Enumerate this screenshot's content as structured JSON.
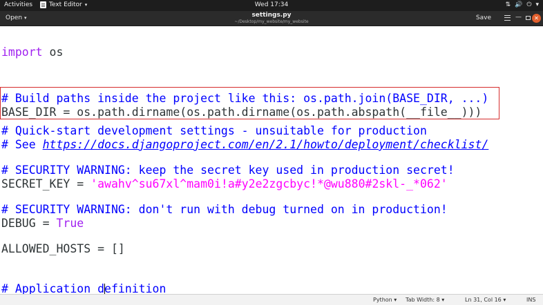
{
  "topbar": {
    "activities": "Activities",
    "app_name": "Text Editor",
    "app_menu_arrow": "▾",
    "clock": "Wed 17:34",
    "tray_network": "⇅",
    "tray_volume": "🔊",
    "tray_power": "⏻",
    "tray_arrow": "▾"
  },
  "headerbar": {
    "open_label": "Open",
    "open_arrow": "▾",
    "title": "settings.py",
    "path": "~/Desktop/my_website/my_website",
    "save_label": "Save",
    "minimize_glyph": "—",
    "close_glyph": "✕"
  },
  "code": {
    "l1": {
      "kw": "import",
      "rest": " os"
    },
    "l2": {
      "comment": "# Build paths inside the project like this: os.path.join(BASE_DIR, ...)"
    },
    "l3": {
      "text": "BASE_DIR = os.path.dirname(os.path.dirname(os.path.abspath(__file__)))"
    },
    "l4": {
      "comment": "# Quick-start development settings - unsuitable for production"
    },
    "l5": {
      "prefix": "# See ",
      "url": "https://docs.djangoproject.com/en/2.1/howto/deployment/checklist/"
    },
    "l6": {
      "comment": "# SECURITY WARNING: keep the secret key used in production secret!"
    },
    "l7": {
      "name": "SECRET_KEY",
      "op": " = ",
      "value": "'awahv^su67xl^mam0i!a#y2e2zgcbyc!*@wu880#2skl-_*062'"
    },
    "l8": {
      "comment": "# SECURITY WARNING: don't run with debug turned on in production!"
    },
    "l9": {
      "name": "DEBUG",
      "op": " = ",
      "value": "True"
    },
    "l10": {
      "text": "ALLOWED_HOSTS = []"
    },
    "l11": {
      "before_cursor": "# Application d",
      "after_cursor": "efinition"
    }
  },
  "statusbar": {
    "language": "Python ▾",
    "tab_width": "Tab Width: 8 ▾",
    "position": "Ln 31, Col 16",
    "arrow": "▾",
    "mode": "INS"
  },
  "colors": {
    "keyword": "#a020f0",
    "comment": "#0000ff",
    "string": "#ff00ff",
    "highlight_border": "#d52b2b"
  }
}
